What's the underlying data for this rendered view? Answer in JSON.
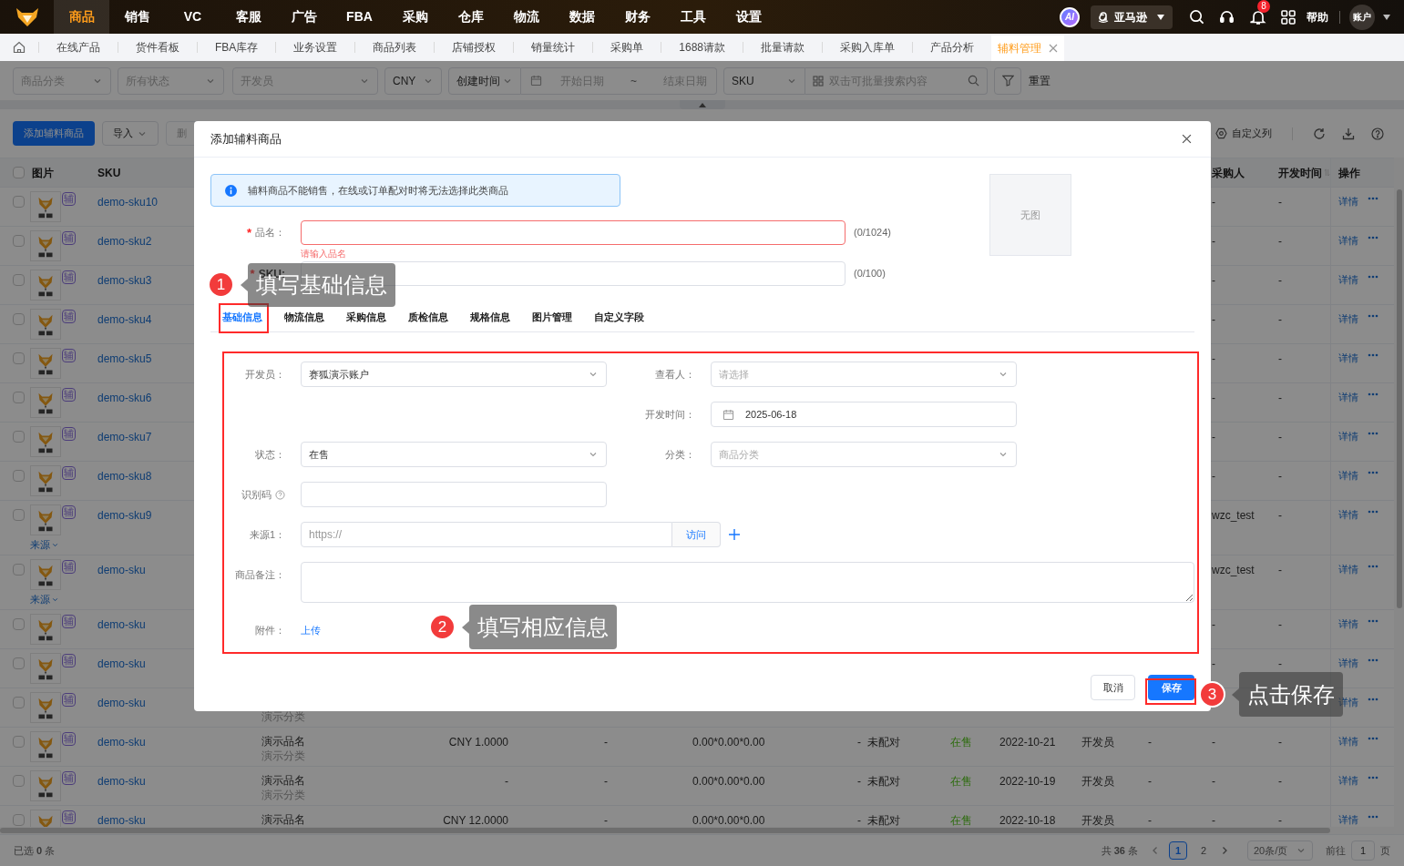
{
  "top_nav": {
    "menu": [
      {
        "label": "商品",
        "selected": true
      },
      {
        "label": "销售",
        "selected": false
      },
      {
        "label": "VC",
        "selected": false
      },
      {
        "label": "客服",
        "selected": false
      },
      {
        "label": "广告",
        "selected": false
      },
      {
        "label": "FBA",
        "selected": false
      },
      {
        "label": "采购",
        "selected": false
      },
      {
        "label": "仓库",
        "selected": false
      },
      {
        "label": "物流",
        "selected": false
      },
      {
        "label": "数据",
        "selected": false
      },
      {
        "label": "财务",
        "selected": false
      },
      {
        "label": "工具",
        "selected": false
      },
      {
        "label": "设置",
        "selected": false
      }
    ],
    "ai": "AI",
    "store": "亚马逊",
    "notifications": "8",
    "help": "帮助",
    "account": "账户"
  },
  "page_tabs": [
    {
      "label": "在线产品",
      "selected": false
    },
    {
      "label": "货件看板",
      "selected": false
    },
    {
      "label": "FBA库存",
      "selected": false
    },
    {
      "label": "业务设置",
      "selected": false
    },
    {
      "label": "商品列表",
      "selected": false
    },
    {
      "label": "店铺授权",
      "selected": false
    },
    {
      "label": "销量统计",
      "selected": false
    },
    {
      "label": "采购单",
      "selected": false
    },
    {
      "label": "1688请款",
      "selected": false
    },
    {
      "label": "批量请款",
      "selected": false
    },
    {
      "label": "采购入库单",
      "selected": false
    },
    {
      "label": "产品分析",
      "selected": false
    },
    {
      "label": "辅料管理",
      "selected": true
    }
  ],
  "filters": [
    {
      "kind": "select",
      "placeholder": "商品分类"
    },
    {
      "kind": "select",
      "placeholder": "所有状态"
    },
    {
      "kind": "select",
      "placeholder": "开发员"
    },
    {
      "kind": "select",
      "value": "CNY"
    },
    {
      "kind": "date_range",
      "type": "创建时间",
      "start_placeholder": "开始日期",
      "separator": "~",
      "end_placeholder": "结束日期"
    },
    {
      "kind": "search",
      "field": "SKU",
      "placeholder": "双击可批量搜索内容"
    }
  ],
  "reset": "重置",
  "toolbar": {
    "add": "添加辅料商品",
    "import": "导入",
    "delete": "删",
    "columns": "自定义列"
  },
  "table": {
    "header_checked": false,
    "columns": {
      "image": "图片",
      "sku": "SKU",
      "buyer": "采购人",
      "dev_time": "开发时间",
      "actions": "操作"
    },
    "rows": [
      {
        "checked": false,
        "tag": "辅",
        "sku": "demo-sku10",
        "buyer": "-",
        "dev_time": "-",
        "detail": "详情"
      },
      {
        "checked": false,
        "tag": "辅",
        "sku": "demo-sku2",
        "buyer": "-",
        "dev_time": "-",
        "detail": "详情"
      },
      {
        "checked": false,
        "tag": "辅",
        "sku": "demo-sku3",
        "buyer": "-",
        "dev_time": "-",
        "detail": "详情"
      },
      {
        "checked": false,
        "tag": "辅",
        "sku": "demo-sku4",
        "buyer": "-",
        "dev_time": "-",
        "detail": "详情"
      },
      {
        "checked": false,
        "tag": "辅",
        "sku": "demo-sku5",
        "buyer": "-",
        "dev_time": "-",
        "detail": "详情"
      },
      {
        "checked": false,
        "tag": "辅",
        "sku": "demo-sku6",
        "buyer": "-",
        "dev_time": "-",
        "detail": "详情"
      },
      {
        "checked": false,
        "tag": "辅",
        "sku": "demo-sku7",
        "buyer": "-",
        "dev_time": "-",
        "detail": "详情"
      },
      {
        "checked": false,
        "tag": "辅",
        "sku": "demo-sku8",
        "buyer": "-",
        "dev_time": "-",
        "detail": "详情"
      },
      {
        "checked": false,
        "tag": "辅",
        "sku": "demo-sku9",
        "source": "来源",
        "buyer": "wzc_test",
        "dev_time": "-",
        "detail": "详情"
      },
      {
        "checked": false,
        "tag": "辅",
        "sku": "demo-sku",
        "source": "来源",
        "buyer": "wzc_test",
        "dev_time": "-",
        "detail": "详情"
      },
      {
        "checked": false,
        "tag": "辅",
        "sku": "demo-sku",
        "buyer": "-",
        "dev_time": "-",
        "detail": "详情"
      },
      {
        "checked": false,
        "tag": "辅",
        "sku": "demo-sku",
        "buyer": "-",
        "dev_time": "-",
        "detail": "详情"
      },
      {
        "checked": false,
        "tag": "辅",
        "sku": "demo-sku",
        "category": "演示分类",
        "detail": "详情"
      },
      {
        "checked": false,
        "tag": "辅",
        "sku": "demo-sku",
        "name": "演示品名",
        "category": "演示分类",
        "price": "CNY 1.0000",
        "column_6": "-",
        "size": "0.00*0.00*0.00",
        "column_8": "-",
        "match": "未配对",
        "status": "在售",
        "date": "2022-10-21",
        "column_12": "开发员",
        "column_13": "-",
        "buyer": "-",
        "dev_time": "-",
        "detail": "详情"
      },
      {
        "checked": false,
        "tag": "辅",
        "sku": "demo-sku",
        "name": "演示品名",
        "category": "演示分类",
        "price": "-",
        "column_6": "-",
        "size": "0.00*0.00*0.00",
        "column_8": "-",
        "match": "未配对",
        "status": "在售",
        "date": "2022-10-19",
        "column_12": "开发员",
        "column_13": "-",
        "buyer": "-",
        "dev_time": "-",
        "detail": "详情"
      },
      {
        "checked": false,
        "tag": "辅",
        "sku": "demo-sku",
        "name": "演示品名",
        "price": "CNY 12.0000",
        "column_6": "-",
        "size": "0.00*0.00*0.00",
        "column_8": "-",
        "match": "未配对",
        "status": "在售",
        "date": "2022-10-18",
        "column_12": "开发员",
        "column_13": "-",
        "buyer": "-",
        "dev_time": "-",
        "detail": "详情"
      }
    ]
  },
  "footer": {
    "selected": "已选 **0** 条",
    "total": "共 **36** 条",
    "pages": [
      {
        "label": "1",
        "selected": true
      },
      {
        "label": "2",
        "selected": false
      }
    ],
    "page_size": "20条/页",
    "goto": "前往",
    "goto_value": "1",
    "goto_suffix": "页"
  },
  "dialog": {
    "title": "添加辅料商品",
    "notice": "辅料商品不能销售，在线或订单配对时将无法选择此类商品",
    "no_image": "无图",
    "name_field": {
      "label": "品名：",
      "required_mark": "*",
      "counter": "(0/1024)",
      "error": "请输入品名"
    },
    "sku_field": {
      "label": "SKU:",
      "required_mark": "*",
      "counter": "(0/100)"
    },
    "tabs": [
      {
        "label": "基础信息",
        "selected": true
      },
      {
        "label": "物流信息",
        "selected": false
      },
      {
        "label": "采购信息",
        "selected": false
      },
      {
        "label": "质检信息",
        "selected": false
      },
      {
        "label": "规格信息",
        "selected": false
      },
      {
        "label": "图片管理",
        "selected": false
      },
      {
        "label": "自定义字段",
        "selected": false
      }
    ],
    "rows": [
      {
        "left": {
          "kind": "select",
          "label": "开发员：",
          "value": "赛狐演示账户"
        },
        "right": {
          "kind": "select",
          "label": "查看人：",
          "placeholder": "请选择"
        }
      },
      {
        "right": {
          "kind": "date",
          "label": "开发时间：",
          "value": "2025-06-18"
        }
      },
      {
        "left": {
          "kind": "select",
          "label": "状态：",
          "value": "在售"
        },
        "right": {
          "kind": "select",
          "label": "分类：",
          "placeholder": "商品分类"
        }
      },
      {
        "left": {
          "kind": "input",
          "label": "识别码",
          "help": true
        }
      },
      {
        "left": {
          "kind": "url",
          "label": "来源1：",
          "placeholder": "https://",
          "button": "访问"
        }
      },
      {
        "full": {
          "kind": "textarea",
          "label": "商品备注："
        }
      },
      {
        "left": {
          "kind": "upload",
          "label": "附件：",
          "link": "上传"
        }
      }
    ],
    "buttons": [
      {
        "label": "取消",
        "kind": "default"
      },
      {
        "label": "保存",
        "kind": "primary"
      }
    ]
  },
  "annotations": [
    {
      "number": "1",
      "text": "填写基础信息"
    },
    {
      "number": "2",
      "text": "填写相应信息"
    },
    {
      "number": "3",
      "text": "点击保存"
    }
  ]
}
